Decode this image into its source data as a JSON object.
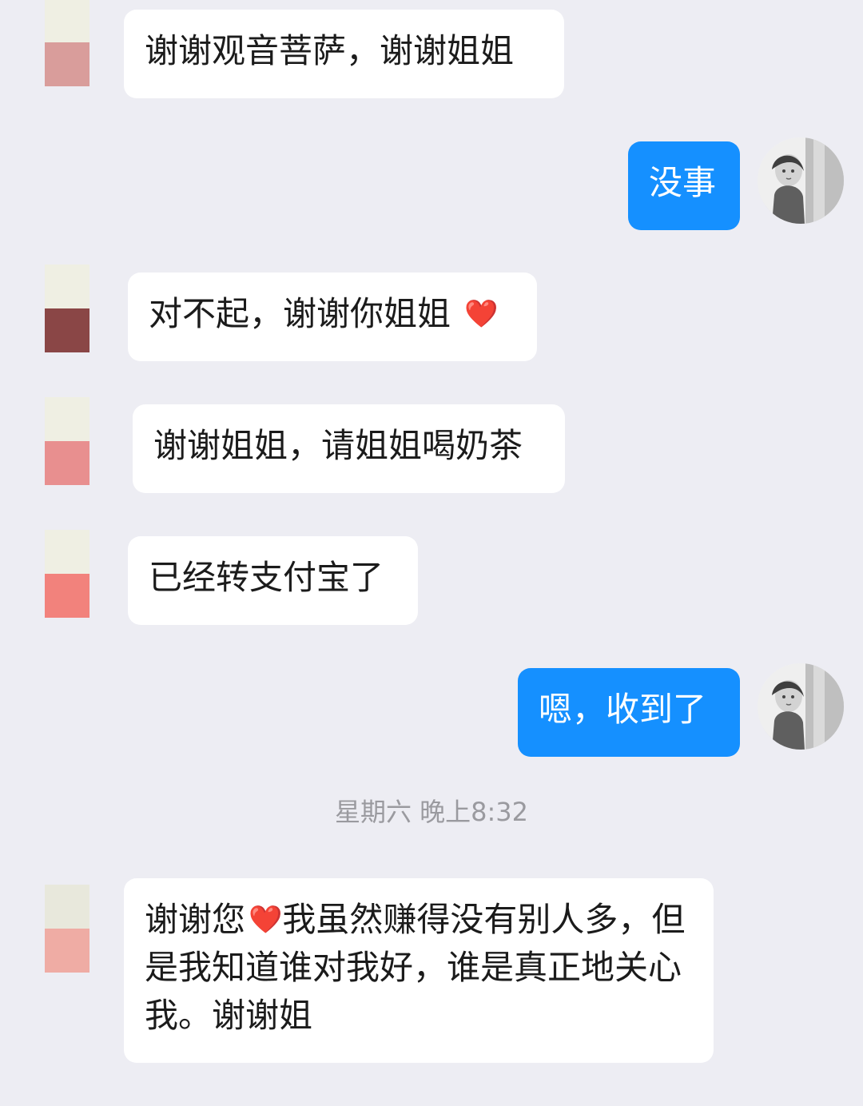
{
  "chat": {
    "messages": [
      {
        "id": "msg1",
        "direction": "incoming",
        "text": "谢谢观音菩萨，谢谢姐姐",
        "avatar_colors": [
          "#efefe3",
          "#d99d9b"
        ]
      },
      {
        "id": "msg2",
        "direction": "outgoing",
        "text": "没事"
      },
      {
        "id": "msg3",
        "direction": "incoming",
        "text": "对不起，谢谢你姐姐",
        "emoji": "❤️",
        "avatar_colors": [
          "#efefe3",
          "#8a4646"
        ]
      },
      {
        "id": "msg4",
        "direction": "incoming",
        "text": "谢谢姐姐，请姐姐喝奶茶",
        "avatar_colors": [
          "#efefe3",
          "#e88f8f"
        ]
      },
      {
        "id": "msg5",
        "direction": "incoming",
        "text": "已经转支付宝了",
        "avatar_colors": [
          "#efefe3",
          "#f2827c"
        ]
      },
      {
        "id": "msg6",
        "direction": "outgoing",
        "text": "嗯，收到了"
      },
      {
        "id": "msg7",
        "direction": "incoming",
        "text_before_emoji": "谢谢您",
        "emoji": "❤️",
        "text_after_emoji": "我虽然赚得没有别人多，但是我知道谁对我好，谁是真正地关心我。谢谢姐",
        "avatar_colors": [
          "#e8e8dc",
          "#efaca4"
        ]
      }
    ],
    "timestamp": "星期六 晚上8:32"
  },
  "icons": {
    "heart": "heart-emoji-icon",
    "self_avatar": "user-avatar-icon"
  },
  "colors": {
    "background": "#ededf3",
    "incoming_bubble": "#ffffff",
    "outgoing_bubble": "#1590ff",
    "outgoing_text": "#ffffff",
    "timestamp_text": "#9a9a9f",
    "heart": "#e72d2d"
  }
}
